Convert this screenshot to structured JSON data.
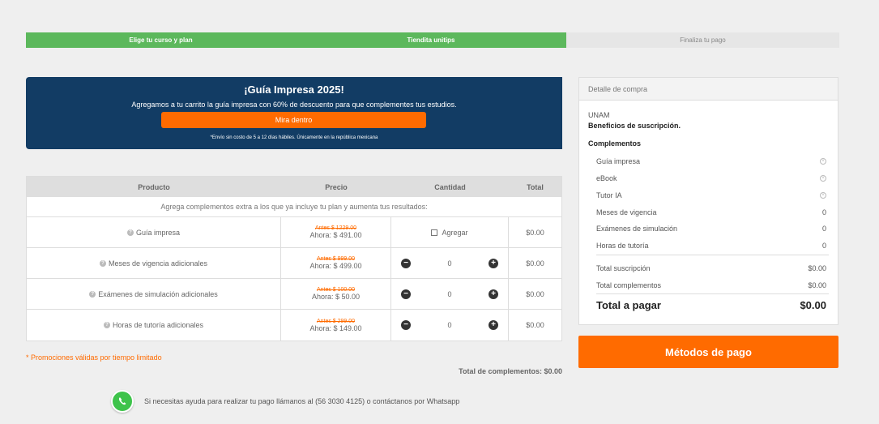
{
  "steps": [
    {
      "label": "Elige tu curso y plan",
      "state": "done"
    },
    {
      "label": "Tiendita unitips",
      "state": "done"
    },
    {
      "label": "Finaliza tu pago",
      "state": "todo"
    }
  ],
  "promo": {
    "title": "¡Guía Impresa 2025!",
    "text": "Agregamos a tu carrito la guía impresa con 60% de descuento para que complementes tus estudios.",
    "button": "Mira dentro",
    "note": "*Envío sin costo de 5 a 12 días hábiles. Únicamente en la república mexicana"
  },
  "table": {
    "headers": [
      "Producto",
      "Precio",
      "Cantidad",
      "Total"
    ],
    "subheader": "Agrega complementos extra a los que ya incluye tu plan y aumenta tus resultados:",
    "rows": [
      {
        "name": "Guía impresa",
        "old": "Antes $ 1229.00",
        "now": "Ahora: $ 491.00",
        "mode": "checkbox",
        "check_label": "Agregar",
        "total": "$0.00"
      },
      {
        "name": "Meses de vigencia adicionales",
        "old": "Antes $ 999.00",
        "now": "Ahora: $ 499.00",
        "mode": "stepper",
        "qty": "0",
        "total": "$0.00"
      },
      {
        "name": "Exámenes de simulación adicionales",
        "old": "Antes $ 100.00",
        "now": "Ahora: $ 50.00",
        "mode": "stepper",
        "qty": "0",
        "total": "$0.00"
      },
      {
        "name": "Horas de tutoría adicionales",
        "old": "Antes $ 299.00",
        "now": "Ahora: $ 149.00",
        "mode": "stepper",
        "qty": "0",
        "total": "$0.00"
      }
    ]
  },
  "promo_valid": "* Promociones válidas por tiempo limitado",
  "complements_total": "Total de complementos: $0.00",
  "help_text": "Si necesitas ayuda para realizar tu pago llámanos al (56 3030 4125) o contáctanos por Whatsapp",
  "summary": {
    "header": "Detalle de compra",
    "institution": "UNAM",
    "benefits": "Beneficios de suscripción.",
    "complements_title": "Complementos",
    "items": [
      {
        "label": "Guía impresa",
        "value": "⊗"
      },
      {
        "label": "eBook",
        "value": "⊗"
      },
      {
        "label": "Tutor IA",
        "value": "⊗"
      },
      {
        "label": "Meses de vigencia",
        "value": "0"
      },
      {
        "label": "Exámenes de simulación",
        "value": "0"
      },
      {
        "label": "Horas de tutoría",
        "value": "0"
      }
    ],
    "total_sub_label": "Total suscripción",
    "total_sub_value": "$0.00",
    "total_comp_label": "Total complementos",
    "total_comp_value": "$0.00",
    "grand_label": "Total a pagar",
    "grand_value": "$0.00"
  },
  "pay_button": "Métodos de pago",
  "colors": {
    "accent": "#ff6b00",
    "done": "#5cb85c",
    "banner": "#123c64"
  },
  "icons": {
    "help": "question-circle-icon",
    "minus": "minus-circle-icon",
    "plus": "plus-circle-icon",
    "whatsapp": "whatsapp-icon",
    "remove": "x-circle-icon"
  }
}
